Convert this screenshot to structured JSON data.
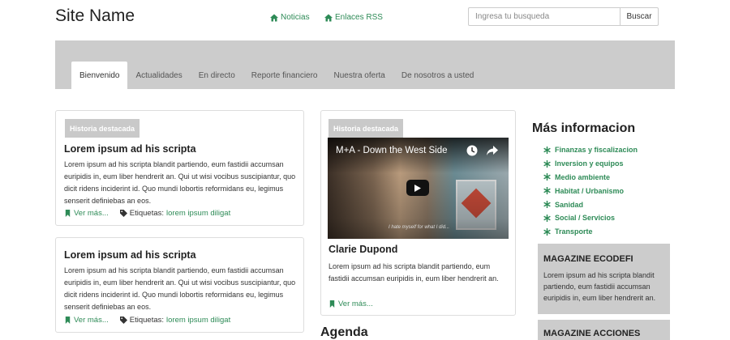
{
  "header": {
    "site_name": "Site Name",
    "links": [
      {
        "label": "Noticias",
        "icon": "home-icon"
      },
      {
        "label": "Enlaces RSS",
        "icon": "home-icon"
      }
    ],
    "search": {
      "placeholder": "Ingresa tu busqueda",
      "value": "",
      "button_label": "Buscar"
    }
  },
  "nav": {
    "tabs": [
      {
        "label": "Bienvenido",
        "active": true
      },
      {
        "label": "Actualidades",
        "active": false
      },
      {
        "label": "En directo",
        "active": false
      },
      {
        "label": "Reporte financiero",
        "active": false
      },
      {
        "label": "Nuestra oferta",
        "active": false
      },
      {
        "label": "De nosotros a usted",
        "active": false
      }
    ]
  },
  "featured": [
    {
      "badge": "Historia destacada",
      "title": "Lorem ipsum ad his scripta",
      "body": "Lorem ipsum ad his scripta blandit partiendo, eum fastidii accumsan euripidis in, eum liber hendrerit an. Qui ut wisi vocibus suscipiantur, quo dicit ridens inciderint id. Quo mundi lobortis reformidans eu, legimus senserit definiebas an eos.",
      "read_more": "Ver más...",
      "tags_label": "Etiquetas:",
      "tags": "lorem ipsum diligat"
    },
    {
      "badge": "",
      "title": "Lorem ipsum ad his scripta",
      "body": "Lorem ipsum ad his scripta blandit partiendo, eum fastidii accumsan euripidis in, eum liber hendrerit an. Qui ut wisi vocibus suscipiantur, quo dicit ridens inciderint id. Quo mundi lobortis reformidans eu, legimus senserit definiebas an eos.",
      "read_more": "Ver más...",
      "tags_label": "Etiquetas:",
      "tags": "lorem ipsum diligat"
    }
  ],
  "video_card": {
    "badge": "Historia destacada",
    "video_title": "M+A - Down the West Side",
    "video_caption": "I hate myself for what I did...",
    "title": "Clarie Dupond",
    "body": "Lorem ipsum ad his scripta blandit partiendo, eum fastidii accumsan euripidis in, eum liber hendrerit an.",
    "read_more": "Ver más..."
  },
  "agenda": {
    "title": "Agenda"
  },
  "sidebar": {
    "title": "Más informacion",
    "items": [
      "Finanzas y fiscalizacion",
      "Inversion y equipos",
      "Medio ambiente",
      "Habitat / Urbanismo",
      "Sanidad",
      "Social / Servicios",
      "Transporte"
    ],
    "magazines": [
      {
        "title": "MAGAZINE ECODEFI",
        "body": "Lorem ipsum ad his scripta blandit partiendo, eum fastidii accumsan euripidis in, eum liber hendrerit an."
      },
      {
        "title": "MAGAZINE ACCIONES",
        "body": ""
      }
    ]
  },
  "colors": {
    "accent": "#2e8b57",
    "nav_band": "#cccccc",
    "badge": "#c9c9c9"
  }
}
